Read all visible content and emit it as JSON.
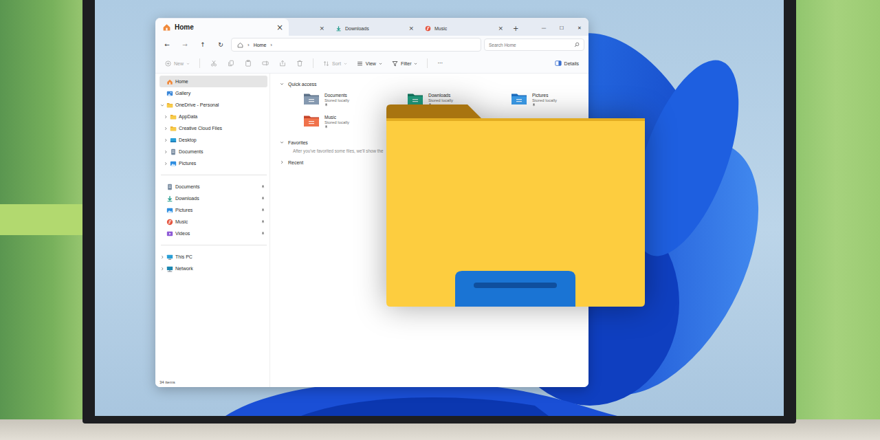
{
  "window": {
    "title": "Home",
    "controls": [
      "—",
      "☐",
      "✕"
    ]
  },
  "tabs": [
    {
      "label": "Home",
      "selected": true,
      "close": "×"
    },
    {
      "label": "",
      "selected": false,
      "close": "×"
    },
    {
      "label": "Downloads",
      "selected": false,
      "close": "×"
    },
    {
      "label": "Music",
      "selected": false,
      "close": "×"
    }
  ],
  "new_tab": "+",
  "nav": {
    "back": {
      "glyph": "←",
      "disabled": false
    },
    "forward": {
      "glyph": "→",
      "disabled": true
    },
    "up": {
      "glyph": "↑",
      "disabled": false
    },
    "refresh": {
      "glyph": "↻",
      "disabled": false
    }
  },
  "address": {
    "separator": "›",
    "path": [
      "Home"
    ]
  },
  "search": {
    "placeholder": "Search Home"
  },
  "toolbar": {
    "new": {
      "label": "New",
      "disabled": true
    },
    "edit_disabled": true,
    "sort": {
      "label": "Sort",
      "disabled": true
    },
    "view": {
      "label": "View",
      "disabled": false
    },
    "filter": {
      "label": "Filter",
      "disabled": false
    },
    "more": "···",
    "details": "Details"
  },
  "sidebar": {
    "sections": [
      {
        "items": [
          {
            "label": "Home",
            "selected": true,
            "child": false,
            "expandable": false,
            "expanded": false,
            "pinned": false
          },
          {
            "label": "Gallery",
            "selected": false,
            "child": false,
            "expandable": false,
            "expanded": false,
            "pinned": false
          },
          {
            "label": "OneDrive - Personal",
            "selected": false,
            "child": false,
            "expandable": true,
            "expanded": true,
            "pinned": false
          },
          {
            "label": "AppData",
            "selected": false,
            "child": true,
            "expandable": true,
            "expanded": false,
            "pinned": false
          },
          {
            "label": "Creative Cloud Files",
            "selected": false,
            "child": true,
            "expandable": true,
            "expanded": false,
            "pinned": false
          },
          {
            "label": "Desktop",
            "selected": false,
            "child": true,
            "expandable": true,
            "expanded": false,
            "pinned": false
          },
          {
            "label": "Documents",
            "selected": false,
            "child": true,
            "expandable": true,
            "expanded": false,
            "pinned": false
          },
          {
            "label": "Pictures",
            "selected": false,
            "child": true,
            "expandable": true,
            "expanded": false,
            "pinned": false
          }
        ]
      },
      {
        "items": [
          {
            "label": "Documents",
            "selected": false,
            "child": false,
            "expandable": false,
            "expanded": false,
            "pinned": true
          },
          {
            "label": "Downloads",
            "selected": false,
            "child": false,
            "expandable": false,
            "expanded": false,
            "pinned": true
          },
          {
            "label": "Pictures",
            "selected": false,
            "child": false,
            "expandable": false,
            "expanded": false,
            "pinned": true
          },
          {
            "label": "Music",
            "selected": false,
            "child": false,
            "expandable": false,
            "expanded": false,
            "pinned": true
          },
          {
            "label": "Videos",
            "selected": false,
            "child": false,
            "expandable": false,
            "expanded": false,
            "pinned": true
          }
        ]
      },
      {
        "items": [
          {
            "label": "This PC",
            "selected": false,
            "child": false,
            "expandable": true,
            "expanded": false,
            "pinned": false
          },
          {
            "label": "Network",
            "selected": false,
            "child": false,
            "expandable": true,
            "expanded": false,
            "pinned": false
          }
        ]
      }
    ]
  },
  "content": {
    "sections": [
      {
        "title": "Quick access",
        "expanded": true,
        "items": [
          {
            "name": "Documents",
            "note": "Stored locally",
            "pinned": true
          },
          {
            "name": "Downloads",
            "note": "Stored locally",
            "pinned": true
          },
          {
            "name": "Pictures",
            "note": "Stored locally",
            "pinned": true
          },
          {
            "name": "Music",
            "note": "Stored locally",
            "pinned": true
          }
        ],
        "message": ""
      },
      {
        "title": "Favorites",
        "expanded": true,
        "items": [],
        "message": "After you've favorited some files, we'll show the"
      },
      {
        "title": "Recent",
        "expanded": false,
        "items": [],
        "message": ""
      }
    ]
  },
  "status_bar": {
    "count": "34 items"
  }
}
